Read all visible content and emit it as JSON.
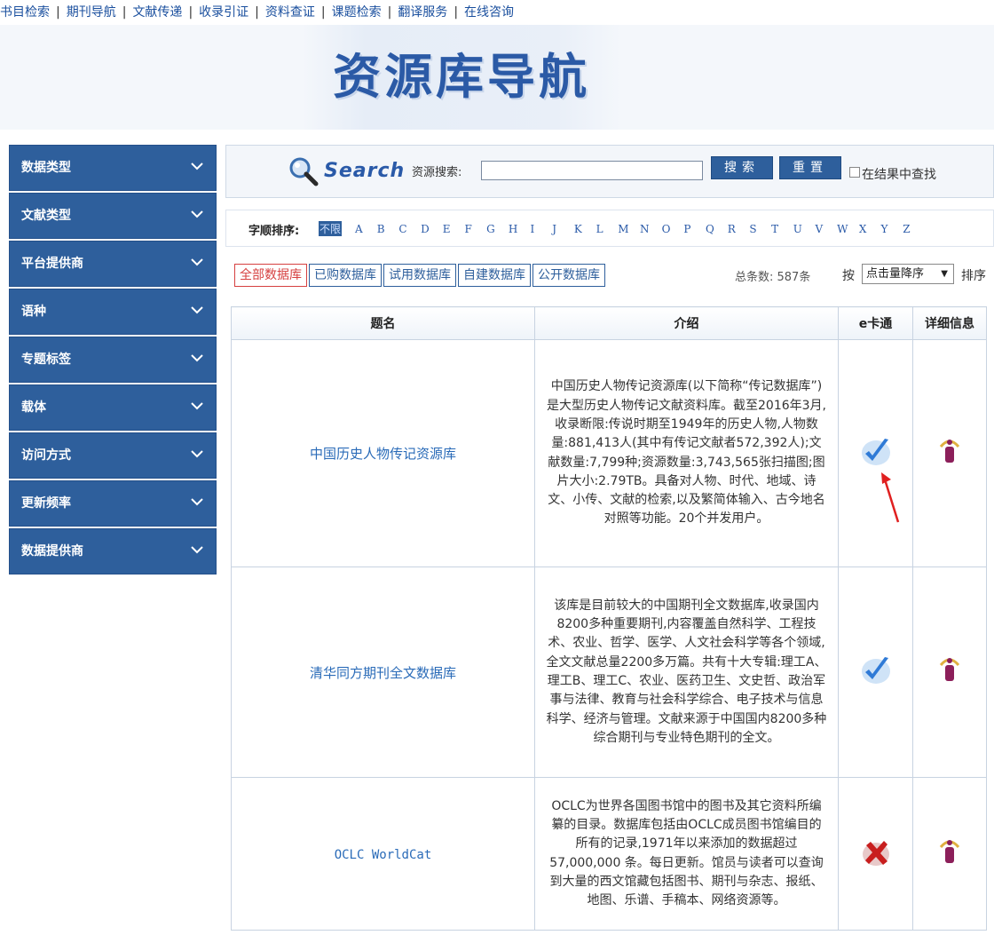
{
  "topnav": {
    "items": [
      "书目检索",
      "期刊导航",
      "文献传递",
      "收录引证",
      "资料查证",
      "课题检索",
      "翻译服务",
      "在线咨询"
    ],
    "separator": "|"
  },
  "banner": {
    "title": "资源库导航"
  },
  "sidebar": {
    "items": [
      {
        "label": "数据类型"
      },
      {
        "label": "文献类型"
      },
      {
        "label": "平台提供商"
      },
      {
        "label": "语种"
      },
      {
        "label": "专题标签"
      },
      {
        "label": "载体"
      },
      {
        "label": "访问方式"
      },
      {
        "label": "更新频率"
      },
      {
        "label": "数据提供商"
      }
    ]
  },
  "search": {
    "logo_text": "Search",
    "label": "资源搜索:",
    "value": "",
    "search_button": "搜索",
    "reset_button": "重置",
    "within_results_label": "在结果中查找",
    "within_results_checked": false
  },
  "alpha": {
    "label": "字顺排序:",
    "all": "不限",
    "letters": [
      "A",
      "B",
      "C",
      "D",
      "E",
      "F",
      "G",
      "H",
      "I",
      "J",
      "K",
      "L",
      "M",
      "N",
      "O",
      "P",
      "Q",
      "R",
      "S",
      "T",
      "U",
      "V",
      "W",
      "X",
      "Y",
      "Z"
    ]
  },
  "tabs": {
    "items": [
      "全部数据库",
      "已购数据库",
      "试用数据库",
      "自建数据库",
      "公开数据库"
    ],
    "active_index": 0
  },
  "summary": {
    "total": "总条数: 587条",
    "sort_prefix": "按",
    "sort_value": "点击量降序",
    "sort_suffix": "排序"
  },
  "table": {
    "headers": {
      "name": "题名",
      "intro": "介绍",
      "ecard": "e卡通",
      "detail": "详细信息"
    },
    "rows": [
      {
        "name": "中国历史人物传记资源库",
        "intro": "中国历史人物传记资源库(以下简称“传记数据库”)是大型历史人物传记文献资料库。截至2016年3月,收录断限:传说时期至1949年的历史人物,人物数量:881,413人(其中有传记文献者572,392人);文献数量:7,799种;资源数量:3,743,565张扫描图;图片大小:2.79TB。具备对人物、时代、地域、诗文、小传、文献的检索,以及繁简体输入、古今地名对照等功能。20个并发用户。",
        "ecard": "check-icon",
        "detail": "info-icon"
      },
      {
        "name": "清华同方期刊全文数据库",
        "intro": "该库是目前较大的中国期刊全文数据库,收录国内8200多种重要期刊,内容覆盖自然科学、工程技术、农业、哲学、医学、人文社会科学等各个领域,全文文献总量2200多万篇。共有十大专辑:理工A、理工B、理工C、农业、医药卫生、文史哲、政治军事与法律、教育与社会科学综合、电子技术与信息科学、经济与管理。文献来源于中国国内8200多种综合期刊与专业特色期刊的全文。",
        "ecard": "check-icon",
        "detail": "info-icon"
      },
      {
        "name": "OCLC WorldCat",
        "intro": "OCLC为世界各国图书馆中的图书及其它资料所编纂的目录。数据库包括由OCLC成员图书馆编目的所有的记录,1971年以来添加的数据超过57,000,000 条。每日更新。馆员与读者可以查询到大量的西文馆藏包括图书、期刊与杂志、报纸、地图、乐谱、手稿本、网络资源等。",
        "ecard": "cross-icon",
        "detail": "info-icon"
      }
    ]
  },
  "colors": {
    "nav_link": "#1a4f9e",
    "sidebar_bg": "#2e5f9c",
    "active_tab": "#d64040",
    "annotation_arrow": "#e02020"
  }
}
